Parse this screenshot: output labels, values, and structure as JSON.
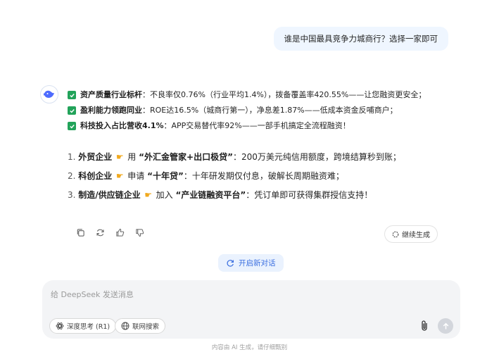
{
  "user_message": "谁是中国最具竞争力城商行？选择一家即可",
  "bullets": [
    {
      "title": "资产质量行业标杆",
      "text": "：不良率仅0.76%（行业平均1.4%），拨备覆盖率420.55%——让您融资更安全；"
    },
    {
      "title": "盈利能力领跑同业",
      "text": "：ROE达16.5%（城商行第一），净息差1.87%——低成本资金反哺商户；"
    },
    {
      "title": "科技投入占比营收4.1%",
      "text": "：APP交易替代率92%——一部手机搞定全流程融资！"
    }
  ],
  "numbered": [
    {
      "num": "1.",
      "who": "外贸企业",
      "verb": "用",
      "product": "“外汇金管家+出口极贷”",
      "desc": "：200万美元纯信用额度，跨境结算秒到账；"
    },
    {
      "num": "2.",
      "who": "科创企业",
      "verb": "申请",
      "product": "“十年贷”",
      "desc": "：十年研发期仅付息，破解长周期融资难；"
    },
    {
      "num": "3.",
      "who": "制造/供应链企业",
      "verb": "加入",
      "product": "“产业链融资平台”",
      "desc": "：凭订单即可获得集群授信支持！"
    }
  ],
  "actions": {
    "continue_label": "继续生成",
    "new_chat_label": "开启新对话"
  },
  "input": {
    "placeholder": "给 DeepSeek 发送消息",
    "deep_think_label": "深度思考 (R1)",
    "web_search_label": "联网搜索"
  },
  "footer": "内容由 AI 生成，请仔细甄别",
  "colors": {
    "accent": "#3b6fe0",
    "check_green": "#22a35a",
    "user_bubble": "#eff6ff",
    "input_bg": "#f3f4f6"
  }
}
